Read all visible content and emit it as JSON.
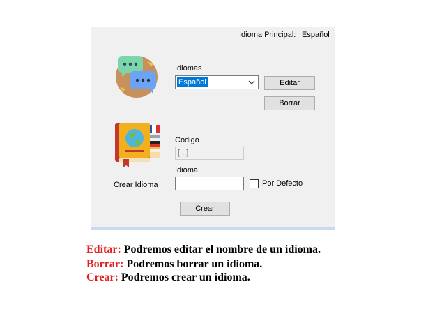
{
  "header": {
    "label": "Idioma Principal:",
    "value": "Español"
  },
  "languages_section": {
    "label": "Idiomas",
    "selected": "Español",
    "edit_button": "Editar",
    "delete_button": "Borrar"
  },
  "create_section": {
    "title": "Crear Idioma",
    "code_label": "Codigo",
    "code_value": "[...]",
    "language_label": "Idioma",
    "language_value": "",
    "default_checkbox_label": "Por Defecto",
    "default_checked": false,
    "create_button": "Crear"
  },
  "descriptions": [
    {
      "term": "Editar:",
      "text": " Podremos editar el nombre de un idioma."
    },
    {
      "term": "Borrar:",
      "text": " Podremos borrar un idioma."
    },
    {
      "term": "Crear:",
      "text": " Podremos crear un idioma."
    }
  ],
  "icons": {
    "chat": "chat-bubbles-icon",
    "book": "dictionary-book-icon"
  },
  "colors": {
    "window_bg": "#f0f0f0",
    "selection": "#0078d7",
    "button_bg": "#e1e1e1",
    "term": "#e02020"
  }
}
